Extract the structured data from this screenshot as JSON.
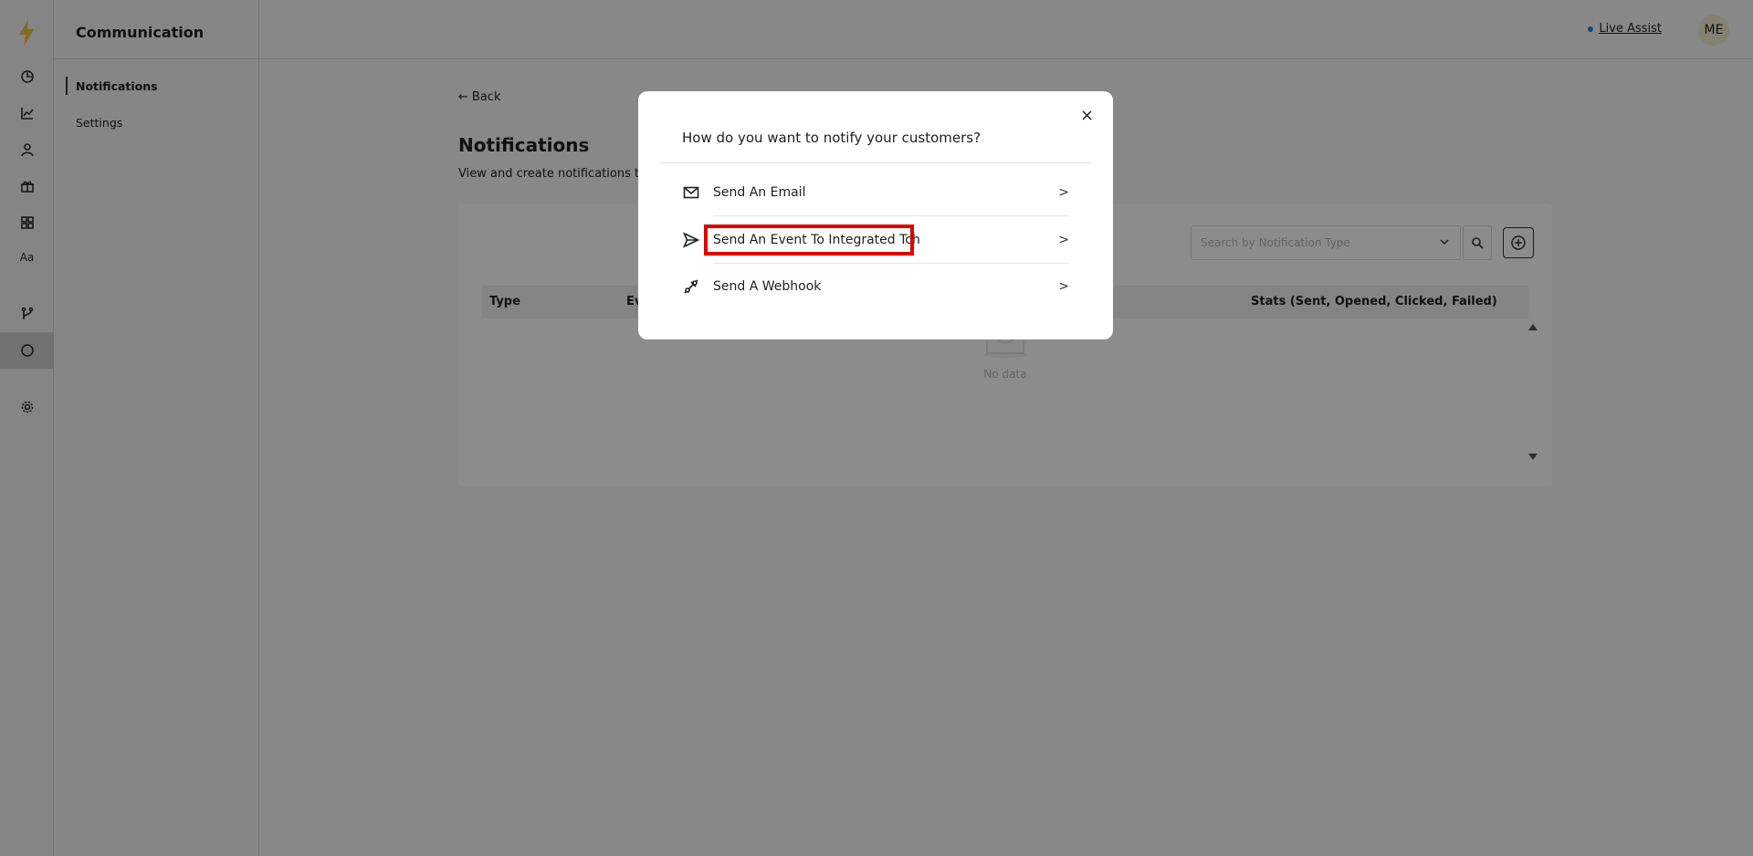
{
  "rail": {
    "items": [
      "logo-icon",
      "pie-chart-icon",
      "line-chart-icon",
      "user-icon",
      "gift-icon",
      "widgets-icon",
      "font-icon",
      "branch-icon",
      "chat-icon",
      "gear-icon"
    ],
    "font_label": "Aa",
    "active": "chat-icon"
  },
  "sidebar": {
    "title": "Communication",
    "items": [
      {
        "label": "Notifications",
        "active": true
      },
      {
        "label": "Settings",
        "active": false
      }
    ]
  },
  "header": {
    "live_assist": "Live Assist",
    "avatar_initials": "ME"
  },
  "main": {
    "back_label": "Back",
    "title": "Notifications",
    "description": "View and create notifications t",
    "search_placeholder": "Search by Notification Type",
    "columns": [
      "Type",
      "Ev",
      "Stats (Sent, Opened, Clicked, Failed)"
    ],
    "empty_text": "No data"
  },
  "modal": {
    "question": "How do you want to notify your customers?",
    "options": [
      {
        "label": "Send An Email",
        "icon": "mail-icon"
      },
      {
        "label": "Send An Event To Integrated Tch",
        "icon": "send-icon"
      },
      {
        "label": "Send A Webhook",
        "icon": "webhook-icon"
      }
    ],
    "close_symbol": "×"
  },
  "colors": {
    "highlight": "#e10000",
    "logo": "#f2c23d",
    "live_dot": "#1b7fe0"
  }
}
